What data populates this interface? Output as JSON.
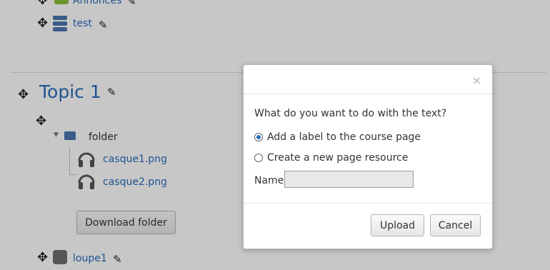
{
  "background": {
    "annonces_label": "Annonces",
    "test_label": "test",
    "topic_title": "Topic 1",
    "folder_label": "folder",
    "files": [
      "casque1.png",
      "casque2.png"
    ],
    "download_button": "Download folder",
    "loupe_label": "loupe1"
  },
  "modal": {
    "close_glyph": "×",
    "question": "What do you want to do with the text?",
    "options": [
      {
        "label": "Add a label to the course page",
        "checked": true
      },
      {
        "label": "Create a new page resource",
        "checked": false
      }
    ],
    "name_label": "Name",
    "name_value": "",
    "upload_button": "Upload",
    "cancel_button": "Cancel"
  },
  "icons": {
    "move": "move-icon",
    "edit": "pencil-icon",
    "forum": "forum-icon",
    "database": "database-icon",
    "folder": "folder-icon",
    "headphones": "headphones-icon",
    "loupe": "loupe-icon",
    "collapse": "triangle-down-icon"
  },
  "colors": {
    "link": "#2a6ebb",
    "overlay": "rgba(0,0,0,0.22)"
  }
}
